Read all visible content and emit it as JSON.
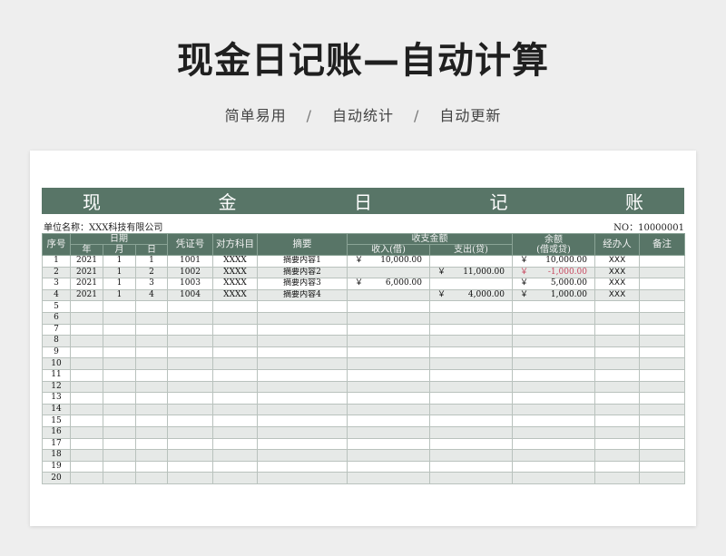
{
  "header": {
    "title": "现金日记账—自动计算",
    "features": [
      "简单易用",
      "自动统计",
      "自动更新"
    ],
    "separator": "/"
  },
  "sheet": {
    "title_chars": [
      "现",
      "金",
      "日",
      "记",
      "账"
    ],
    "unit_label": "单位名称：",
    "unit_name": "XXX科技有限公司",
    "no_label": "NO：",
    "no_value": "10000001"
  },
  "columns": {
    "seq": "序号",
    "date": "日期",
    "year": "年",
    "month": "月",
    "day": "日",
    "voucher": "凭证号",
    "counter": "对方科目",
    "summary": "摘要",
    "amount": "收支金额",
    "income": "收入(借)",
    "expense": "支出(贷)",
    "balance": "余额",
    "balance_sub": "(借或贷)",
    "handler": "经办人",
    "remark": "备注"
  },
  "currency_symbol": "￥",
  "rows": [
    {
      "seq": "1",
      "year": "2021",
      "month": "1",
      "day": "1",
      "voucher": "1001",
      "counter": "XXXX",
      "summary": "摘要内容1",
      "income": "10,000.00",
      "expense": "",
      "balance": "10,000.00",
      "balance_negative": false,
      "handler": "XXX",
      "remark": ""
    },
    {
      "seq": "2",
      "year": "2021",
      "month": "1",
      "day": "2",
      "voucher": "1002",
      "counter": "XXXX",
      "summary": "摘要内容2",
      "income": "",
      "expense": "11,000.00",
      "balance": "-1,000.00",
      "balance_negative": true,
      "handler": "XXX",
      "remark": ""
    },
    {
      "seq": "3",
      "year": "2021",
      "month": "1",
      "day": "3",
      "voucher": "1003",
      "counter": "XXXX",
      "summary": "摘要内容3",
      "income": "6,000.00",
      "expense": "",
      "balance": "5,000.00",
      "balance_negative": false,
      "handler": "XXX",
      "remark": ""
    },
    {
      "seq": "4",
      "year": "2021",
      "month": "1",
      "day": "4",
      "voucher": "1004",
      "counter": "XXXX",
      "summary": "摘要内容4",
      "income": "",
      "expense": "4,000.00",
      "balance": "1,000.00",
      "balance_negative": false,
      "handler": "XXX",
      "remark": ""
    },
    {
      "seq": "5"
    },
    {
      "seq": "6"
    },
    {
      "seq": "7"
    },
    {
      "seq": "8"
    },
    {
      "seq": "9"
    },
    {
      "seq": "10"
    },
    {
      "seq": "11"
    },
    {
      "seq": "12"
    },
    {
      "seq": "13"
    },
    {
      "seq": "14"
    },
    {
      "seq": "15"
    },
    {
      "seq": "16"
    },
    {
      "seq": "17"
    },
    {
      "seq": "18"
    },
    {
      "seq": "19"
    },
    {
      "seq": "20"
    }
  ],
  "colors": {
    "header_green": "#587567",
    "negative": "#c8475f",
    "stripe": "#e6e9e7"
  }
}
